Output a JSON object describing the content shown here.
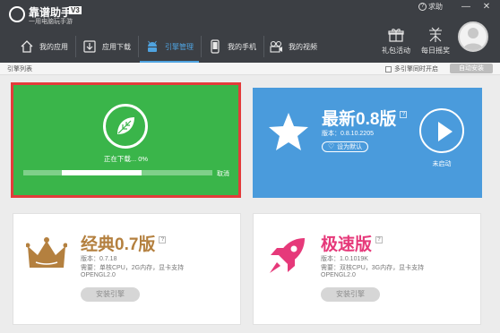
{
  "app": {
    "title": "靠谱助手",
    "version_badge": "V3",
    "slogan": "一用电脑玩手游"
  },
  "window": {
    "help_label": "求助",
    "controls": [
      "minimize-icon",
      "close-icon"
    ]
  },
  "nav": {
    "items": [
      {
        "label": "我的应用",
        "icon": "home-icon"
      },
      {
        "label": "应用下载",
        "icon": "download-icon"
      },
      {
        "label": "引擎管理",
        "icon": "android-icon",
        "active": true
      },
      {
        "label": "我的手机",
        "icon": "phone-icon"
      },
      {
        "label": "我的视频",
        "icon": "video-camera-icon"
      }
    ],
    "active_color": "#4fa3e0"
  },
  "toolbar": {
    "gift_label": "礼包活动",
    "checkin_label": "每日摇奖"
  },
  "subbar": {
    "breadcrumb": "引擎列表",
    "multi_engine_label": "多引擎同时开启",
    "auto_install_label": "自动安装"
  },
  "download_card": {
    "status": "正在下载... 0%",
    "progress": 0.0,
    "cancel_label": "取消",
    "bg_color": "#3ab54a",
    "highlight_color": "#e33b3b"
  },
  "latest_card": {
    "title": "最新0.8版",
    "version": "版本：0.8.10.2205",
    "set_default_label": "设为默认",
    "status": "未启动",
    "bg_color": "#4a9bdc"
  },
  "classic_card": {
    "title": "经典0.7版",
    "version": "版本：0.7.18",
    "requirement": "需要：单核CPU，2G内存，显卡支持",
    "requirement2": "OPENGL2.0",
    "install_label": "安装引擎",
    "accent_color": "#b4803f"
  },
  "speed_card": {
    "title": "极速版",
    "version": "版本：1.0.1019K",
    "requirement": "需要：双核CPU，3G内存，显卡支持",
    "requirement2": "OPENGL2.0",
    "install_label": "安装引擎",
    "accent_color": "#e6397a"
  }
}
